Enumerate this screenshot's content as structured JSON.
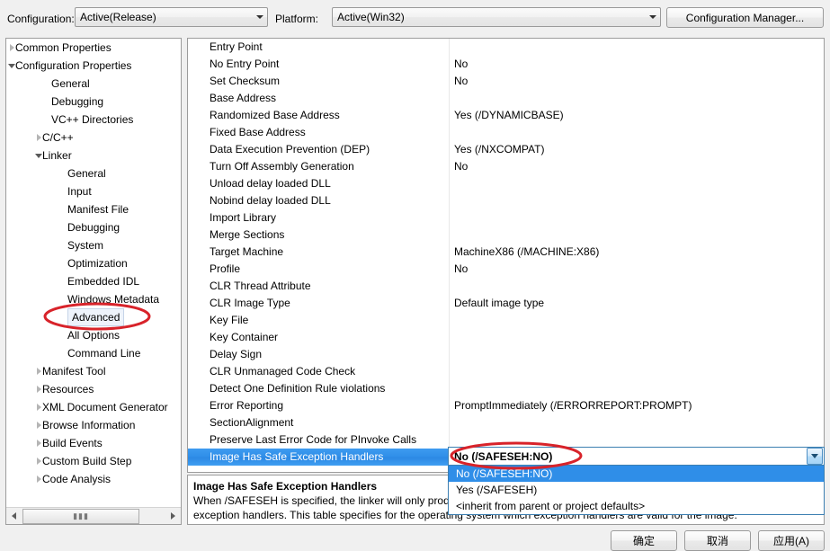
{
  "header": {
    "configuration_label": "Configuration:",
    "configuration_value": "Active(Release)",
    "platform_label": "Platform:",
    "platform_value": "Active(Win32)",
    "configuration_manager_label": "Configuration Manager..."
  },
  "tree": {
    "items": [
      {
        "label": "Common Properties",
        "indent": 10,
        "glyph": "collapsed"
      },
      {
        "label": "Configuration Properties",
        "indent": 10,
        "glyph": "expanded"
      },
      {
        "label": "General",
        "indent": 50,
        "glyph": "none"
      },
      {
        "label": "Debugging",
        "indent": 50,
        "glyph": "none"
      },
      {
        "label": "VC++ Directories",
        "indent": 50,
        "glyph": "none"
      },
      {
        "label": "C/C++",
        "indent": 40,
        "glyph": "collapsed"
      },
      {
        "label": "Linker",
        "indent": 40,
        "glyph": "expanded"
      },
      {
        "label": "General",
        "indent": 68,
        "glyph": "none"
      },
      {
        "label": "Input",
        "indent": 68,
        "glyph": "none"
      },
      {
        "label": "Manifest File",
        "indent": 68,
        "glyph": "none"
      },
      {
        "label": "Debugging",
        "indent": 68,
        "glyph": "none"
      },
      {
        "label": "System",
        "indent": 68,
        "glyph": "none"
      },
      {
        "label": "Optimization",
        "indent": 68,
        "glyph": "none"
      },
      {
        "label": "Embedded IDL",
        "indent": 68,
        "glyph": "none"
      },
      {
        "label": "Windows Metadata",
        "indent": 68,
        "glyph": "none"
      },
      {
        "label": "Advanced",
        "indent": 68,
        "glyph": "none",
        "selected": true
      },
      {
        "label": "All Options",
        "indent": 68,
        "glyph": "none"
      },
      {
        "label": "Command Line",
        "indent": 68,
        "glyph": "none"
      },
      {
        "label": "Manifest Tool",
        "indent": 40,
        "glyph": "collapsed"
      },
      {
        "label": "Resources",
        "indent": 40,
        "glyph": "collapsed"
      },
      {
        "label": "XML Document Generator",
        "indent": 40,
        "glyph": "collapsed"
      },
      {
        "label": "Browse Information",
        "indent": 40,
        "glyph": "collapsed"
      },
      {
        "label": "Build Events",
        "indent": 40,
        "glyph": "collapsed"
      },
      {
        "label": "Custom Build Step",
        "indent": 40,
        "glyph": "collapsed"
      },
      {
        "label": "Code Analysis",
        "indent": 40,
        "glyph": "collapsed"
      }
    ],
    "scrollbar": {
      "left_arrow": "left-arrow-icon",
      "right_arrow": "right-arrow-icon",
      "grip": "▮▮▮"
    }
  },
  "properties": {
    "rows": [
      {
        "name": "Entry Point",
        "value": ""
      },
      {
        "name": "No Entry Point",
        "value": "No"
      },
      {
        "name": "Set Checksum",
        "value": "No"
      },
      {
        "name": "Base Address",
        "value": ""
      },
      {
        "name": "Randomized Base Address",
        "value": "Yes (/DYNAMICBASE)"
      },
      {
        "name": "Fixed Base Address",
        "value": ""
      },
      {
        "name": "Data Execution Prevention (DEP)",
        "value": "Yes (/NXCOMPAT)"
      },
      {
        "name": "Turn Off Assembly Generation",
        "value": "No"
      },
      {
        "name": "Unload delay loaded DLL",
        "value": ""
      },
      {
        "name": "Nobind delay loaded DLL",
        "value": ""
      },
      {
        "name": "Import Library",
        "value": ""
      },
      {
        "name": "Merge Sections",
        "value": ""
      },
      {
        "name": "Target Machine",
        "value": "MachineX86 (/MACHINE:X86)"
      },
      {
        "name": "Profile",
        "value": "No"
      },
      {
        "name": "CLR Thread Attribute",
        "value": ""
      },
      {
        "name": "CLR Image Type",
        "value": "Default image type"
      },
      {
        "name": "Key File",
        "value": ""
      },
      {
        "name": "Key Container",
        "value": ""
      },
      {
        "name": "Delay Sign",
        "value": ""
      },
      {
        "name": "CLR Unmanaged Code Check",
        "value": ""
      },
      {
        "name": "Detect One Definition Rule violations",
        "value": ""
      },
      {
        "name": "Error Reporting",
        "value": "PromptImmediately (/ERRORREPORT:PROMPT)"
      },
      {
        "name": "SectionAlignment",
        "value": ""
      },
      {
        "name": "Preserve Last Error Code for PInvoke Calls",
        "value": ""
      },
      {
        "name": "Image Has Safe Exception Handlers",
        "value": "",
        "selected": true
      }
    ]
  },
  "editor": {
    "current_value": "No (/SAFESEH:NO)",
    "dropdown_arrow": "chevron-down-icon",
    "options": [
      {
        "label": "No (/SAFESEH:NO)",
        "highlighted": true
      },
      {
        "label": "Yes (/SAFESEH)",
        "highlighted": false
      },
      {
        "label": "<inherit from parent or project defaults>",
        "highlighted": false
      }
    ]
  },
  "description": {
    "title": "Image Has Safe Exception Handlers",
    "line1": "When /SAFESEH is specified, the linker will only produce an image if it can also produce a table of the image's safe",
    "line2": "exception handlers. This table specifies for the operating system which exception handlers are valid for the image."
  },
  "footer": {
    "ok_label": "确定",
    "cancel_label": "取消",
    "apply_label": "应用(A)"
  },
  "annotations": {
    "ellipse_color": "#d8232a",
    "ellipse_tree_target": "Advanced",
    "ellipse_value_target": "No (/SAFESEH:NO)"
  }
}
